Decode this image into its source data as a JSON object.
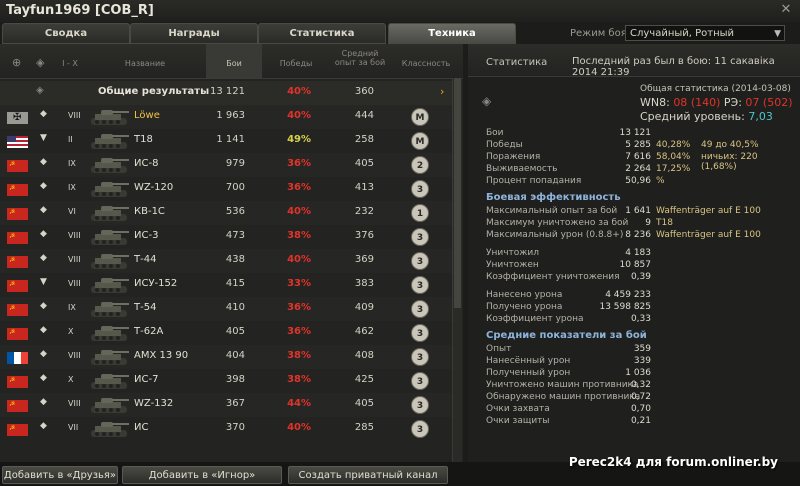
{
  "window": {
    "title": "Tayfun1969 [COB_R]",
    "close": "✕"
  },
  "tabs": [
    "Сводка",
    "Награды",
    "Статистика",
    "Техника"
  ],
  "active_tab": 3,
  "mode": {
    "label": "Режим боя:",
    "value": "Случайный, Ротный"
  },
  "columns": {
    "tier_range": "I - X",
    "name": "Название",
    "battles": "Бои",
    "wins": "Победы",
    "avg_xp": "Средний опыт за бой",
    "mastery": "Классность"
  },
  "total": {
    "label": "Общие результаты",
    "battles": "13 121",
    "wins": "40%",
    "xp": "360",
    "chev": "›"
  },
  "tanks": [
    {
      "flag": "ger",
      "cls": "◆",
      "tier": "VIII",
      "name": "Löwe",
      "gold": true,
      "battles": "1 963",
      "wins": "40%",
      "wins_color": "red",
      "xp": "444",
      "badge": "M"
    },
    {
      "flag": "usa",
      "cls": "▼",
      "tier": "II",
      "name": "T18",
      "gold": false,
      "battles": "1 141",
      "wins": "49%",
      "wins_color": "yellow",
      "xp": "258",
      "badge": "M"
    },
    {
      "flag": "ussr",
      "cls": "◆",
      "tier": "IX",
      "name": "ИС-8",
      "gold": false,
      "battles": "979",
      "wins": "36%",
      "wins_color": "red",
      "xp": "405",
      "badge": "2"
    },
    {
      "flag": "ussr",
      "cls": "◆",
      "tier": "IX",
      "name": "WZ-120",
      "gold": false,
      "battles": "700",
      "wins": "36%",
      "wins_color": "red",
      "xp": "413",
      "badge": "3"
    },
    {
      "flag": "ussr",
      "cls": "◆",
      "tier": "VI",
      "name": "КВ-1С",
      "gold": false,
      "battles": "536",
      "wins": "40%",
      "wins_color": "red",
      "xp": "232",
      "badge": "1"
    },
    {
      "flag": "ussr",
      "cls": "◆",
      "tier": "VIII",
      "name": "ИС-3",
      "gold": false,
      "battles": "473",
      "wins": "38%",
      "wins_color": "red",
      "xp": "376",
      "badge": "3"
    },
    {
      "flag": "ussr",
      "cls": "◆",
      "tier": "VIII",
      "name": "Т-44",
      "gold": false,
      "battles": "438",
      "wins": "40%",
      "wins_color": "red",
      "xp": "369",
      "badge": "3"
    },
    {
      "flag": "ussr",
      "cls": "▼",
      "tier": "VIII",
      "name": "ИСУ-152",
      "gold": false,
      "battles": "415",
      "wins": "33%",
      "wins_color": "red",
      "xp": "383",
      "badge": "3"
    },
    {
      "flag": "ussr",
      "cls": "◆",
      "tier": "IX",
      "name": "Т-54",
      "gold": false,
      "battles": "410",
      "wins": "36%",
      "wins_color": "red",
      "xp": "409",
      "badge": "3"
    },
    {
      "flag": "ussr",
      "cls": "◆",
      "tier": "X",
      "name": "Т-62А",
      "gold": false,
      "battles": "405",
      "wins": "36%",
      "wins_color": "red",
      "xp": "462",
      "badge": "3"
    },
    {
      "flag": "fra",
      "cls": "◆",
      "tier": "VIII",
      "name": "AMX 13 90",
      "gold": false,
      "battles": "404",
      "wins": "38%",
      "wins_color": "red",
      "xp": "408",
      "badge": "3"
    },
    {
      "flag": "ussr",
      "cls": "◆",
      "tier": "X",
      "name": "ИС-7",
      "gold": false,
      "battles": "398",
      "wins": "38%",
      "wins_color": "red",
      "xp": "425",
      "badge": "3"
    },
    {
      "flag": "ussr",
      "cls": "◆",
      "tier": "VIII",
      "name": "WZ-132",
      "gold": false,
      "battles": "367",
      "wins": "44%",
      "wins_color": "red",
      "xp": "405",
      "badge": "3"
    },
    {
      "flag": "ussr",
      "cls": "◆",
      "tier": "VII",
      "name": "ИС",
      "gold": false,
      "battles": "370",
      "wins": "40%",
      "wins_color": "red",
      "xp": "285",
      "badge": "3"
    }
  ],
  "stats": {
    "header": "Статистика",
    "last_battle": "Последний раз был в бою: 11 сакавіка 2014 21:39",
    "general": "Общая статистика (2014-03-08)",
    "wn8_label": "WN8: ",
    "wn8_a": "08",
    "wn8_b": "(140)",
    "re_label": " РЭ: ",
    "re_a": "07",
    "re_b": "(502)",
    "level_label": "Средний уровень: ",
    "level": "7,03",
    "rows1": [
      {
        "label": "Бои",
        "value": "13 121",
        "e1": "",
        "e2": ""
      },
      {
        "label": "Победы",
        "value": "5 285",
        "e1": "40,28%",
        "e2": "49 до 40,5%"
      },
      {
        "label": "Поражения",
        "value": "7 616",
        "e1": "58,04%",
        "e2": "ничьих: 220 (1,68%)"
      },
      {
        "label": "Выживаемость",
        "value": "2 264",
        "e1": "17,25%",
        "e2": ""
      },
      {
        "label": "Процент попадания",
        "value": "50,96",
        "e1": "%",
        "e2": ""
      }
    ],
    "section1": "Боевая эффективность",
    "rows2": [
      {
        "label": "Максимальный опыт за бой",
        "value": "1 641",
        "e1": "Waffenträger auf E 100"
      },
      {
        "label": "Максимум уничтожено за бой",
        "value": "9",
        "e1": "T18"
      },
      {
        "label": "Максимальный урон (0.8.8+)",
        "value": "8 236",
        "e1": "Waffenträger auf E 100"
      }
    ],
    "rows3": [
      {
        "label": "Уничтожил",
        "value": "4 183"
      },
      {
        "label": "Уничтожен",
        "value": "10 857"
      },
      {
        "label": "Коэффициент уничтожения",
        "value": "0,39"
      }
    ],
    "rows4": [
      {
        "label": "Нанесено урона",
        "value": "4 459 233"
      },
      {
        "label": "Получено урона",
        "value": "13 598 825"
      },
      {
        "label": "Коэффициент урона",
        "value": "0,33"
      }
    ],
    "section2": "Средние показатели за бой",
    "rows5": [
      {
        "label": "Опыт",
        "value": "359"
      },
      {
        "label": "Нанесённый урон",
        "value": "339"
      },
      {
        "label": "Полученный урон",
        "value": "1 036"
      },
      {
        "label": "Уничтожено машин противника",
        "value": "0,32"
      },
      {
        "label": "Обнаружено машин противника",
        "value": "0,72"
      },
      {
        "label": "Очки захвата",
        "value": "0,70"
      },
      {
        "label": "Очки защиты",
        "value": "0,21"
      }
    ]
  },
  "buttons": [
    "Добавить в «Друзья»",
    "Добавить в «Игнор»",
    "Создать приватный канал"
  ],
  "watermark": "Perec2k4 для forum.onliner.by",
  "colors": {
    "red": "#e0342a",
    "yellow": "#d8d24a",
    "gold": "#f3c24a",
    "accent_blue": "#8eb4dc",
    "level": "#4fc6c6"
  }
}
